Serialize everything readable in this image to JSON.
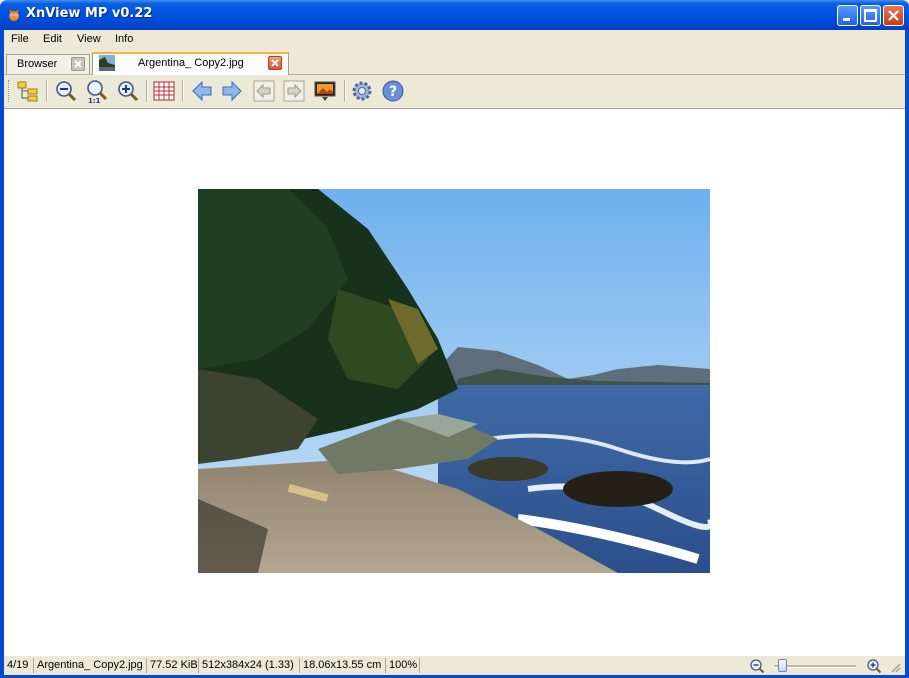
{
  "window": {
    "title": "XnView MP v0.22"
  },
  "menu": {
    "items": [
      "File",
      "Edit",
      "View",
      "Info"
    ]
  },
  "tabs": [
    {
      "label": "Browser",
      "active": false
    },
    {
      "label": "Argentina_ Copy2.jpg",
      "active": true
    }
  ],
  "toolbar": {
    "tools": [
      "browser-tree",
      "zoom-out",
      "zoom-1to1",
      "zoom-in",
      "grid",
      "previous",
      "next",
      "first-page",
      "last-page",
      "fullscreen-slideshow",
      "settings",
      "help"
    ]
  },
  "status": {
    "index": "4/19",
    "filename": "Argentina_ Copy2.jpg",
    "filesize": "77.52 KiB",
    "dimensions": "512x384x24 (1.33)",
    "print_size": "18.06x13.55 cm",
    "zoom": "100%"
  },
  "zoom_slider": {
    "value": 0.1
  },
  "colors": {
    "title_bar": "#0054e3",
    "accent_tab": "#f7b33c",
    "close": "#c43b14"
  }
}
